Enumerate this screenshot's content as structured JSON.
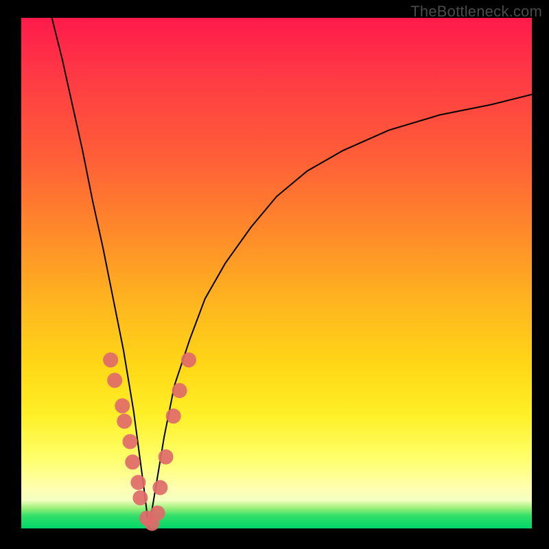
{
  "watermark": "TheBottleneck.com",
  "colors": {
    "frame": "#000000",
    "curve": "#000000",
    "dot": "#e06a6a",
    "gradient_stops": [
      "#ff1a4b",
      "#ff3b44",
      "#ff6037",
      "#ff8a2a",
      "#ffb61f",
      "#ffd716",
      "#fff028",
      "#ffff68",
      "#ffffb0",
      "#f4ffc0",
      "#9df07a",
      "#33e06a",
      "#00d768"
    ]
  },
  "chart_data": {
    "type": "line",
    "title": "",
    "xlabel": "",
    "ylabel": "",
    "x_range": [
      0,
      100
    ],
    "y_range": [
      0,
      100
    ],
    "note": "V-shaped curve; x ≈ normalized performance ratio, y ≈ bottleneck %. Minimum near x≈25 at y≈0. Values estimated from pixels (no axes shown).",
    "series": [
      {
        "name": "bottleneck-curve",
        "x": [
          6,
          8,
          10,
          12,
          14,
          16,
          18,
          20,
          22,
          24,
          25,
          26,
          28,
          30,
          33,
          36,
          40,
          45,
          50,
          56,
          63,
          72,
          82,
          92,
          100
        ],
        "y": [
          100,
          92,
          83,
          74,
          64,
          55,
          45,
          35,
          23,
          8,
          0,
          6,
          18,
          28,
          37,
          45,
          52,
          59,
          65,
          70,
          74,
          78,
          81,
          83,
          85
        ]
      }
    ],
    "danger_markers": {
      "name": "highlighted-region-dots",
      "note": "Pink dots clustered on both arms of the V in roughly the 20–35% y band and at the trough.",
      "points": [
        {
          "x": 17.5,
          "y": 33
        },
        {
          "x": 18.3,
          "y": 29
        },
        {
          "x": 19.8,
          "y": 24
        },
        {
          "x": 20.2,
          "y": 21
        },
        {
          "x": 21.3,
          "y": 17
        },
        {
          "x": 21.8,
          "y": 13
        },
        {
          "x": 22.9,
          "y": 9
        },
        {
          "x": 23.3,
          "y": 6
        },
        {
          "x": 24.6,
          "y": 2
        },
        {
          "x": 25.6,
          "y": 1
        },
        {
          "x": 26.7,
          "y": 3
        },
        {
          "x": 27.2,
          "y": 8
        },
        {
          "x": 28.3,
          "y": 14
        },
        {
          "x": 29.8,
          "y": 22
        },
        {
          "x": 31.0,
          "y": 27
        },
        {
          "x": 32.8,
          "y": 33
        }
      ]
    }
  }
}
